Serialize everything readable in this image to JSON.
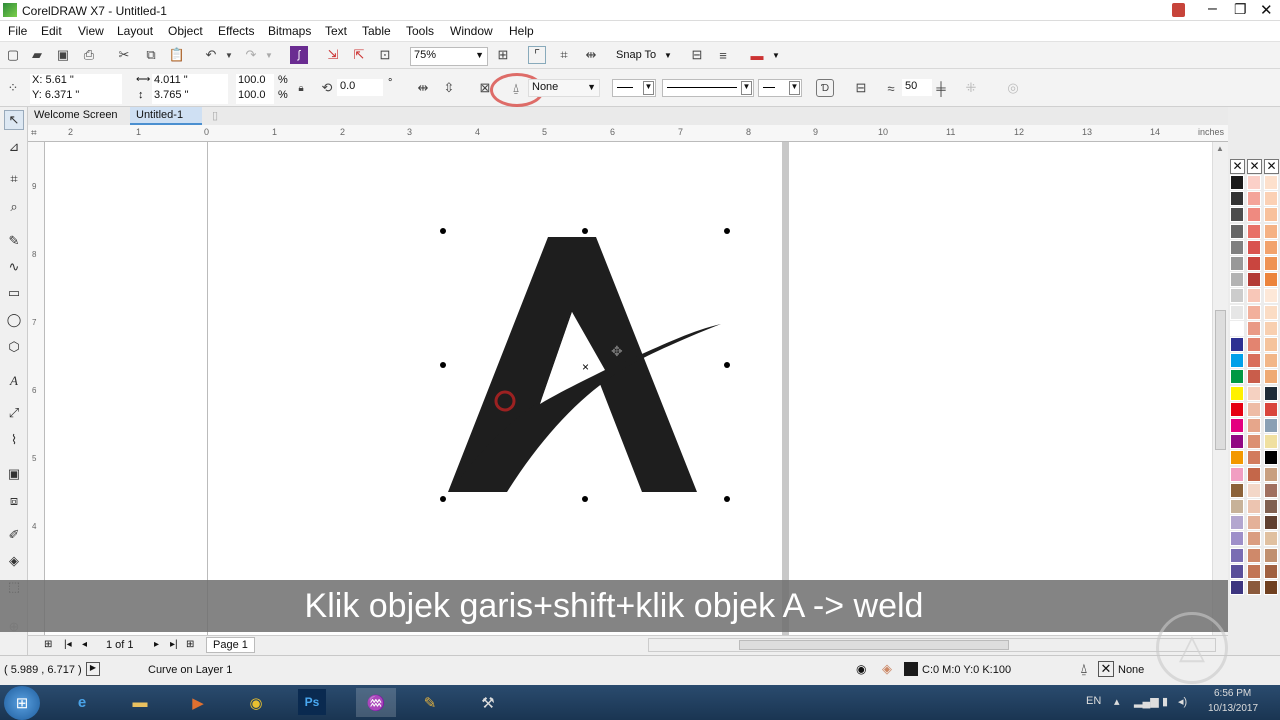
{
  "window": {
    "title": "CorelDRAW X7 - Untitled-1"
  },
  "menu": [
    "File",
    "Edit",
    "View",
    "Layout",
    "Object",
    "Effects",
    "Bitmaps",
    "Text",
    "Table",
    "Tools",
    "Window",
    "Help"
  ],
  "toolbar": {
    "zoom": "75%",
    "snap_label": "Snap To"
  },
  "property_bar": {
    "x": "X: 5.61 \"",
    "y": "Y: 6.371 \"",
    "width": "4.011 \"",
    "height": "3.765 \"",
    "scale_w": "100.0",
    "scale_h": "100.0",
    "percent": "%",
    "rotation": "0.0",
    "degree": "°",
    "outline": "None",
    "nodes": "50"
  },
  "tabs": {
    "welcome": "Welcome Screen",
    "doc": "Untitled-1"
  },
  "ruler": {
    "h_ticks": [
      "2",
      "1",
      "0",
      "1",
      "2",
      "3",
      "4",
      "5",
      "6",
      "7",
      "8",
      "9",
      "10",
      "11",
      "12",
      "13",
      "14"
    ],
    "unit": "inches",
    "v_ticks": [
      "9",
      "8",
      "7",
      "6",
      "5",
      "4"
    ]
  },
  "doc_nav": {
    "pages": "1 of 1",
    "page_tab": "Page 1"
  },
  "status": {
    "coords": "( 5.989 , 6.717 )",
    "info": "Curve on Layer 1",
    "fill": "C:0 M:0 Y:0 K:100",
    "outline": "None"
  },
  "taskbar": {
    "lang": "EN",
    "time": "6:56 PM",
    "date": "10/13/2017"
  },
  "subtitle": "Klik objek garis+shift+klik objek A -> weld",
  "colors": {
    "accent_red": "#d9534f",
    "letter_fill": "#1e1e1e"
  },
  "palette_left": [
    "#1a1a1a",
    "#333",
    "#4d4d4d",
    "#666",
    "#808080",
    "#999",
    "#b3b3b3",
    "#ccc",
    "#e6e6e6",
    "#fff",
    "#2e3192",
    "#00a0e9",
    "#009944",
    "#fff100",
    "#e60012",
    "#e4007f",
    "#920783",
    "#f39800",
    "#f19ec2",
    "#8c6239",
    "#c7b299",
    "#b3a6cf",
    "#9e8fc9",
    "#7a6db3",
    "#5a4f9a",
    "#3d3580"
  ],
  "palette_mid": [
    "#fbd0c8",
    "#f4a49a",
    "#ef8a80",
    "#e87067",
    "#d9534f",
    "#c9453f",
    "#b33b36",
    "#f8c7b8",
    "#f2b09c",
    "#e99a86",
    "#e38470",
    "#d96e5b",
    "#c95d4b",
    "#f5d1c1",
    "#eebca6",
    "#e6a68b",
    "#dc9072",
    "#d27b5d",
    "#c4674a",
    "#f3d7c8",
    "#ecc4b0",
    "#e4b199",
    "#da9d81",
    "#cf896a",
    "#c27555",
    "#8b5a3c"
  ],
  "palette_right": [
    "#fde0cc",
    "#fbd0b4",
    "#f8c19c",
    "#f5b184",
    "#f2a26c",
    "#ef9354",
    "#ec843c",
    "#fde8d8",
    "#fbdcc4",
    "#f8cfb0",
    "#f5c39c",
    "#f2b688",
    "#efaa74",
    "#1e2b38",
    "#d9453c",
    "#8aa0b4",
    "#f0e0a0",
    "#000",
    "#c8a080",
    "#a07060",
    "#806050",
    "#604030",
    "#e0c0a0",
    "#c09070",
    "#a06040",
    "#704020"
  ]
}
